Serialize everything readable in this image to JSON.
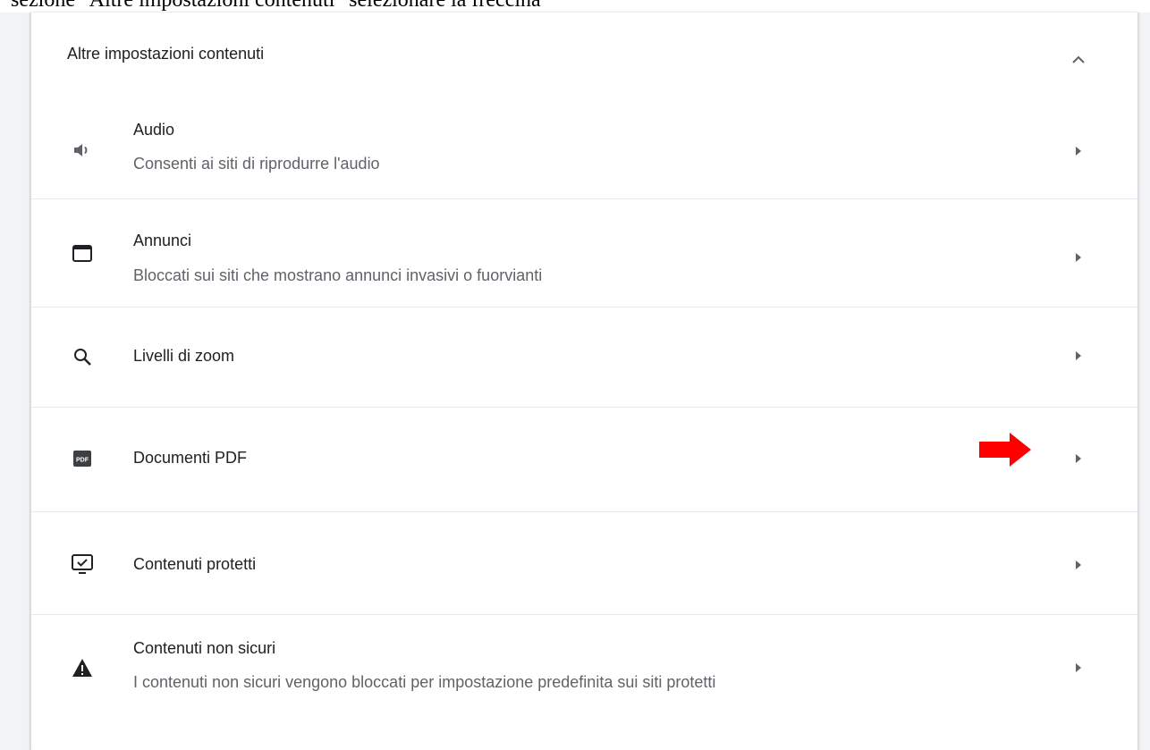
{
  "caption": "sezione \"Altre impostazioni contenuti\" selezionare la freccina",
  "section": {
    "title": "Altre impostazioni contenuti",
    "collapse_icon": "chevron-up-icon"
  },
  "rows": [
    {
      "title": "Audio",
      "subtitle": "Consenti ai siti di riprodurre l'audio",
      "icon": "volume-icon"
    },
    {
      "title": "Annunci",
      "subtitle": "Bloccati sui siti che mostrano annunci invasivi o fuorvianti",
      "icon": "ads-window-icon"
    },
    {
      "title": "Livelli di zoom",
      "subtitle": "",
      "icon": "search-icon"
    },
    {
      "title": "Documenti PDF",
      "subtitle": "",
      "icon": "pdf-icon",
      "icon_text": "PDF"
    },
    {
      "title": "Contenuti protetti",
      "subtitle": "",
      "icon": "protected-content-icon"
    },
    {
      "title": "Contenuti non sicuri",
      "subtitle": "I contenuti non sicuri vengono bloccati per impostazione predefinita sui siti protetti",
      "icon": "warning-icon"
    }
  ],
  "colors": {
    "accent_arrow": "#ff0000",
    "text_primary": "#202124",
    "text_secondary": "#5f6368",
    "icon": "#5f6368"
  }
}
